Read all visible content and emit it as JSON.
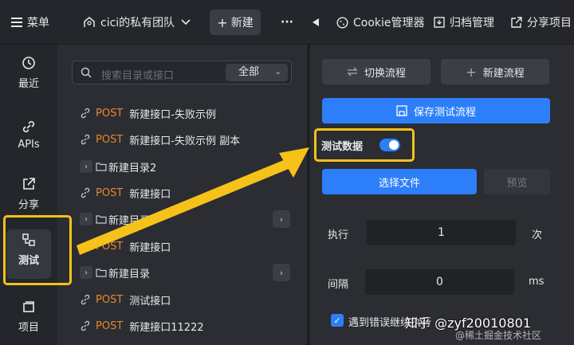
{
  "topbar": {
    "menu_label": "菜单",
    "team_label": "cici的私有团队",
    "new_label": "新建",
    "more_label": "···",
    "cookie_label": "Cookie管理器",
    "archive_label": "归档管理",
    "share_label": "分享项目"
  },
  "sidebar": {
    "recent": "最近",
    "apis": "APIs",
    "share": "分享",
    "test": "测试",
    "project": "项目"
  },
  "tree": {
    "search_placeholder": "搜索目录或接口",
    "filter_value": "全部",
    "items": [
      {
        "method": "POST",
        "name": "新建接口-失败示例"
      },
      {
        "method": "POST",
        "name": "新建接口-失败示例 副本"
      },
      {
        "folder": "新建目录2"
      },
      {
        "method": "POST",
        "name": "新建接口"
      },
      {
        "folder": "新建目录"
      },
      {
        "method": "POST",
        "name": "新建接口"
      },
      {
        "folder": "新建目录"
      },
      {
        "method": "POST",
        "name": "测试接口"
      },
      {
        "method": "POST",
        "name": "新建接口11222"
      }
    ]
  },
  "panel": {
    "switch_flow": "切换流程",
    "new_flow": "新建流程",
    "save_flow": "保存测试流程",
    "test_data_label": "测试数据",
    "choose_file": "选择文件",
    "preview": "预览",
    "exec_label": "执行",
    "exec_value": "1",
    "exec_unit": "次",
    "interval_label": "间隔",
    "interval_value": "0",
    "interval_unit": "ms",
    "stop_on_error": "遇到错误继续执行"
  },
  "watermark": {
    "zhihu": "知乎 @zyf20010801",
    "juejin": "@稀土掘金技术社区"
  },
  "colors": {
    "accent": "#2d7ff9",
    "post_method": "#e8862f",
    "highlight": "#f6c21a"
  }
}
